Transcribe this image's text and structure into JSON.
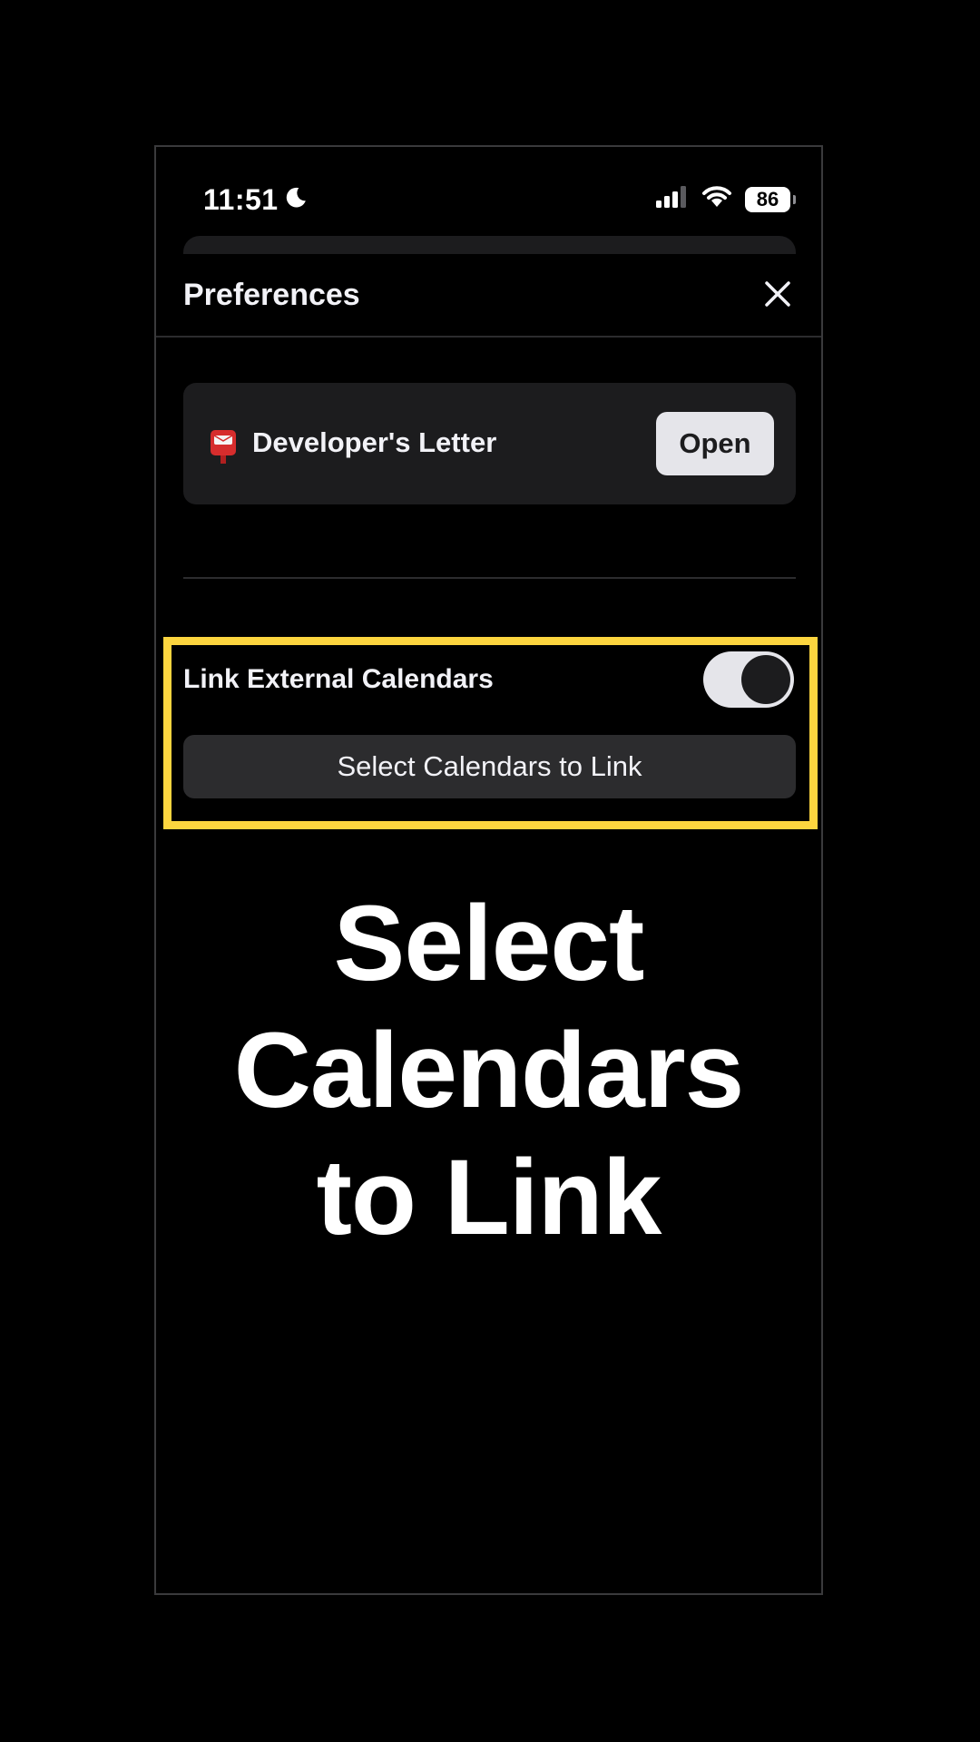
{
  "status_bar": {
    "time": "11:51",
    "battery": "86"
  },
  "header": {
    "title": "Preferences"
  },
  "letter_card": {
    "label": "Developer's Letter",
    "open_label": "Open"
  },
  "calendars": {
    "link_label": "Link External Calendars",
    "toggle_on": true,
    "select_label": "Select Calendars to Link"
  },
  "caption": {
    "text": "Select\nCalendars\nto Link"
  },
  "colors": {
    "highlight": "#fcd53f",
    "card": "#1c1c1e",
    "button": "#2c2c2e"
  }
}
